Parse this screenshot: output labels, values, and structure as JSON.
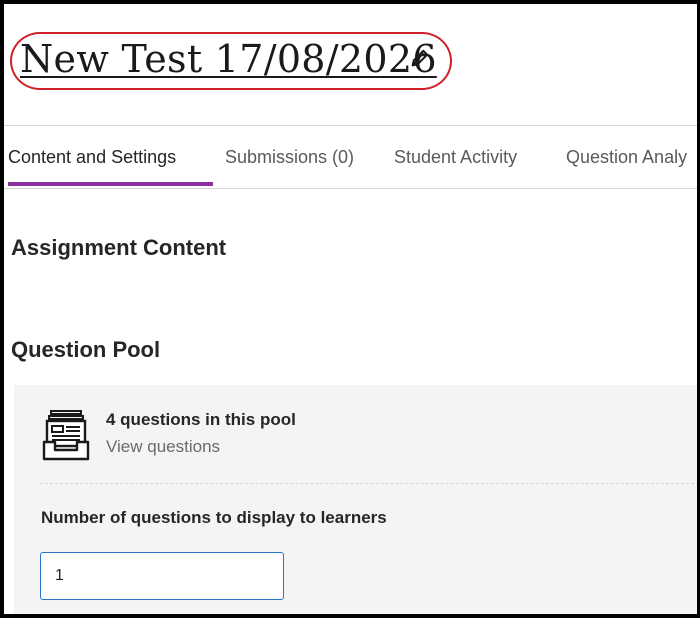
{
  "header": {
    "title": "New Test 17/08/2026",
    "edit_icon": "pencil-icon"
  },
  "tabs": [
    {
      "label": "Content and Settings",
      "active": true
    },
    {
      "label": "Submissions (0)",
      "active": false
    },
    {
      "label": "Student Activity",
      "active": false
    },
    {
      "label": "Question Analy",
      "active": false
    }
  ],
  "content": {
    "assignment_heading": "Assignment Content",
    "pool_heading": "Question Pool",
    "pool": {
      "icon": "question-pool-icon",
      "count_text": "4 questions in this pool",
      "view_link": "View questions",
      "display_label": "Number of questions to display to learners",
      "display_value": "1"
    }
  },
  "colors": {
    "active_tab_underline": "#8c2f9e",
    "highlight_outline": "#d0202a",
    "input_border": "#2a74c9",
    "panel_background": "#f4f4f4"
  }
}
